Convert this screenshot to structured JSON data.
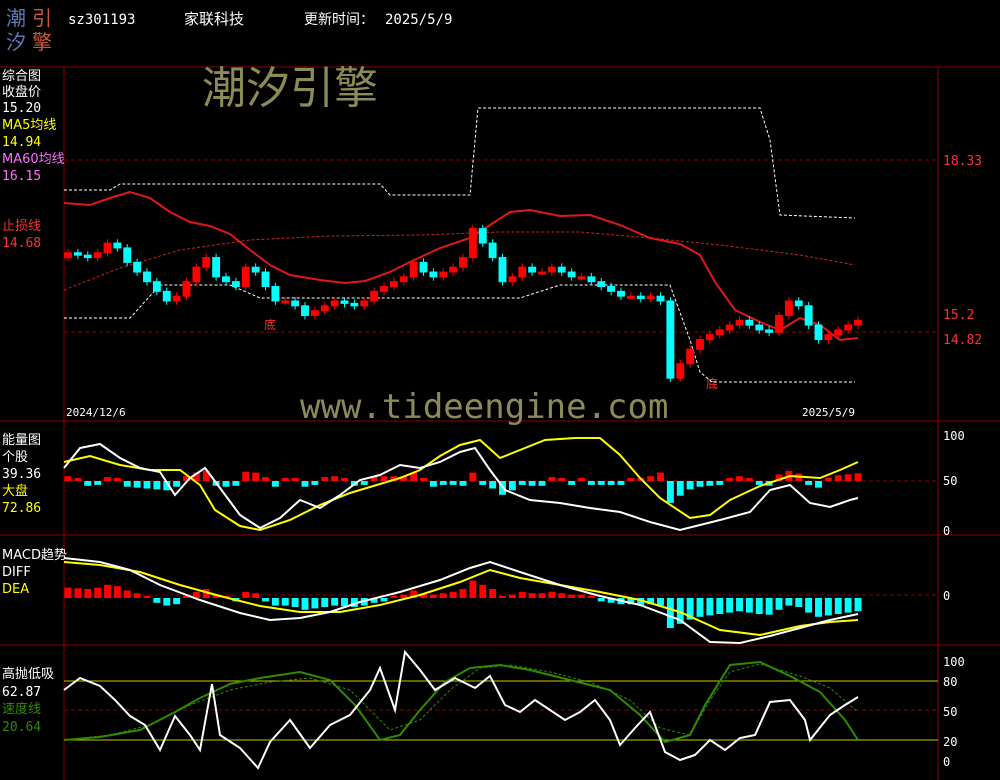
{
  "header": {
    "logo_chars": [
      "潮",
      "引",
      "汐",
      "擎"
    ],
    "code": "sz301193",
    "name": "家联科技",
    "update_label": "更新时间：",
    "update_date": "2025/5/9"
  },
  "watermark": {
    "brand": "潮汐引擎",
    "url": "www.tideengine.com"
  },
  "colors": {
    "up": "#ff0000",
    "down": "#00ffff",
    "grid": "#8b0000",
    "yellow": "#ffff00",
    "white": "#ffffff",
    "green": "#2e8b00",
    "magenta": "#ff6eff",
    "watermark": "#8b8b5a"
  },
  "panels": {
    "main": {
      "title": "综合图",
      "close_label": "收盘价",
      "close_value": "15.20",
      "ma5_label": "MA5均线",
      "ma5_value": "14.94",
      "ma60_label": "MA60均线",
      "ma60_value": "16.15",
      "stop_label": "止损线",
      "stop_value": "14.68",
      "axis_labels": [
        "18.33",
        "15.2",
        "14.82"
      ],
      "date_start": "2024/12/6",
      "date_end": "2025/5/9",
      "bottom_marker": "底"
    },
    "energy": {
      "title": "能量图",
      "stock_label": "个股",
      "stock_value": "39.36",
      "market_label": "大盘",
      "market_value": "72.86",
      "axis_labels": [
        "100",
        "50",
        "0"
      ]
    },
    "macd": {
      "title": "MACD趋势",
      "diff_label": "DIFF",
      "dea_label": "DEA",
      "axis_labels": [
        "0"
      ]
    },
    "tide": {
      "title": "高抛低吸",
      "value": "62.87",
      "speed_label": "速度线",
      "speed_value": "20.64",
      "axis_labels": [
        "100",
        "80",
        "50",
        "20",
        "0"
      ]
    }
  },
  "chart_data": {
    "type": "candlestick",
    "ohlc_scale": {
      "max": 19.6,
      "min": 13.9
    },
    "closes": [
      16.6,
      16.55,
      16.5,
      16.6,
      16.8,
      16.7,
      16.4,
      16.2,
      16.0,
      15.8,
      15.6,
      15.7,
      16.0,
      16.3,
      16.5,
      16.1,
      16.0,
      15.9,
      16.3,
      16.2,
      15.9,
      15.6,
      15.6,
      15.5,
      15.3,
      15.4,
      15.5,
      15.6,
      15.55,
      15.5,
      15.6,
      15.8,
      15.9,
      16.0,
      16.1,
      16.4,
      16.2,
      16.1,
      16.2,
      16.3,
      16.5,
      17.1,
      16.8,
      16.5,
      16.0,
      16.1,
      16.3,
      16.2,
      16.2,
      16.3,
      16.2,
      16.1,
      16.1,
      16.0,
      15.9,
      15.8,
      15.7,
      15.7,
      15.65,
      15.7,
      15.6,
      14.0,
      14.3,
      14.6,
      14.8,
      14.9,
      15.0,
      15.1,
      15.2,
      15.1,
      15.0,
      14.95,
      15.3,
      15.6,
      15.5,
      15.1,
      14.8,
      14.9,
      15.0,
      15.1,
      15.2
    ],
    "ma5": [
      16.5,
      16.55,
      16.6,
      16.65,
      16.75,
      16.7,
      16.55,
      16.4,
      16.25,
      16.1,
      15.95,
      15.85,
      15.9,
      16.0,
      16.1,
      16.2,
      16.15,
      16.0,
      15.95,
      15.9,
      15.85,
      15.75,
      15.6,
      15.5,
      15.45,
      15.45,
      15.45,
      15.5,
      15.55,
      15.6,
      15.65,
      15.7,
      15.8,
      15.9,
      16.0,
      16.1,
      16.2,
      16.25,
      16.25,
      16.35,
      16.6,
      16.8,
      16.85,
      16.75,
      16.6,
      16.45,
      16.35,
      16.3,
      16.3,
      16.25,
      16.2,
      16.15,
      16.1,
      16.05,
      15.95,
      15.85,
      15.75,
      15.7,
      15.65,
      15.6,
      15.3,
      15.05,
      14.95,
      14.9,
      14.95,
      15.0,
      15.05,
      15.1,
      15.1,
      15.1,
      15.05,
      15.05,
      15.1,
      15.2,
      15.25,
      15.15,
      15.0,
      14.9,
      14.85,
      14.9,
      14.94
    ],
    "ma60": [
      15.45,
      15.5,
      15.55,
      15.6,
      15.65,
      15.7,
      15.75,
      15.8,
      15.85,
      15.9,
      15.93,
      15.96,
      16.0,
      16.02,
      16.04,
      16.06,
      16.08,
      16.1,
      16.12,
      16.13,
      16.14,
      16.15,
      16.16,
      16.16,
      16.17,
      16.17,
      16.17,
      16.16,
      16.15
    ],
    "energy": {
      "stock_last": 39.36,
      "market_last": 72.86,
      "range": [
        0,
        100
      ]
    },
    "tide": {
      "value_last": 62.87,
      "speed_last": 20.64,
      "levels": [
        100,
        80,
        50,
        20,
        0
      ]
    }
  }
}
